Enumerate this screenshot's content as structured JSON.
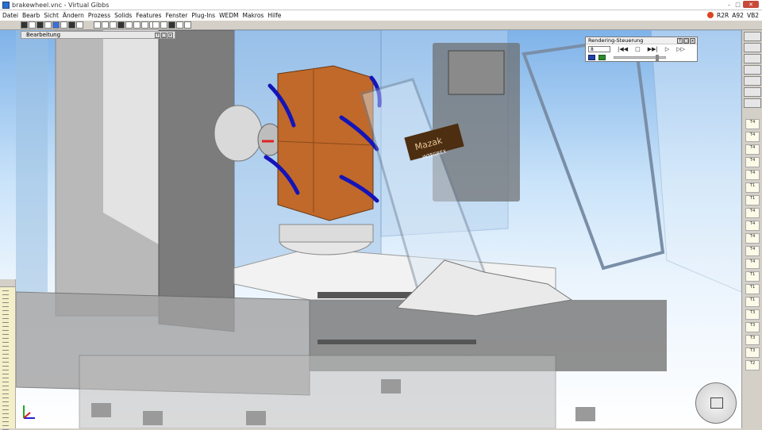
{
  "window": {
    "title": "brakewheel.vnc - Virtual Gibbs",
    "controls": [
      "–",
      "□",
      "✕"
    ]
  },
  "menu": {
    "items": [
      "Datei",
      "Bearb",
      "Sicht",
      "Ändern",
      "Prozess",
      "Solids",
      "Features",
      "Fenster",
      "Plug-Ins",
      "WEDM",
      "Makros",
      "Hilfe"
    ],
    "right_labels": [
      "R2R",
      "A92",
      "VB2"
    ]
  },
  "bearbeitung_bar": {
    "label": "Bearbeitung"
  },
  "render_panel": {
    "title": "Rendering-Steuerung",
    "frame_value": "8",
    "controls": [
      "|◀◀",
      "□",
      "▶▶|",
      "▷",
      "▷▷"
    ]
  },
  "tool_palette": {
    "items": [
      "T4",
      "T4",
      "T4",
      "T4",
      "T4",
      "T1",
      "T1",
      "T4",
      "T4",
      "T4",
      "T4",
      "T4",
      "T1",
      "T1",
      "T1",
      "T3",
      "T3",
      "T3",
      "T3",
      "T2"
    ]
  },
  "scene": {
    "machine_sign": "Mazak",
    "machine_sign_sub": "INTEGREX"
  },
  "colors": {
    "sky_top": "#7fb3e9",
    "sky_bottom": "#ffffff",
    "fixture_orange": "#c0692a",
    "clamp_blue": "#1414b8",
    "machine_gray": "#8c8c8c"
  },
  "icons": [
    "app-icon",
    "minimize-icon",
    "maximize-icon",
    "close-icon",
    "navigation-cube-icon",
    "axis-triad-icon"
  ]
}
